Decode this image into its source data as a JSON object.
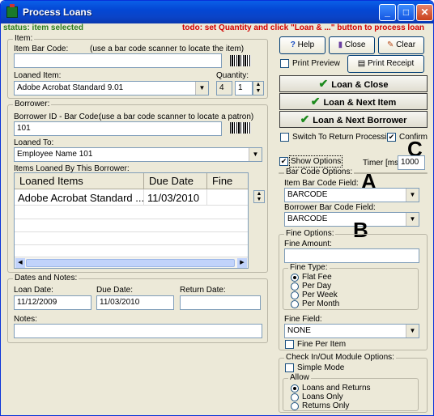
{
  "window": {
    "title": "Process Loans",
    "min": "_",
    "max": "□",
    "close": "✕"
  },
  "status": {
    "left": "status: item selected",
    "right": "todo: set Quantity and click \"Loan & ...\" button to process loan"
  },
  "item": {
    "group": "Item:",
    "barcode_label": "Item Bar Code:",
    "barcode_hint": "(use a bar code scanner to locate the item)",
    "barcode_value": "",
    "loaned_label": "Loaned Item:",
    "loaned_value": "Adobe Acrobat Standard 9.01",
    "quantity_label": "Quantity:",
    "quantity_available": "4",
    "quantity_value": "1"
  },
  "borrower": {
    "group": "Borrower:",
    "id_label": "Borrower ID - Bar Code:",
    "id_hint": "(use a bar code scanner to locate a patron)",
    "id_value": "101",
    "loaned_to_label": "Loaned To:",
    "loaned_to_value": "Employee Name 101",
    "items_label": "Items Loaned By This Borrower:",
    "columns": [
      "Loaned Items",
      "Due Date",
      "Fine"
    ],
    "rows": [
      {
        "item": "Adobe Acrobat Standard ...",
        "due": "11/03/2010",
        "fine": ""
      }
    ]
  },
  "dates": {
    "group": "Dates and Notes:",
    "loan_label": "Loan Date:",
    "loan_value": "11/12/2009",
    "due_label": "Due Date:",
    "due_value": "11/03/2010",
    "return_label": "Return Date:",
    "return_value": "",
    "notes_label": "Notes:",
    "notes_value": ""
  },
  "toolbar": {
    "help": "Help",
    "close": "Close",
    "clear": "Clear",
    "print_preview": "Print Preview",
    "print_receipt": "Print Receipt",
    "loan_close": "Loan & Close",
    "loan_next_item": "Loan & Next Item",
    "loan_next_borrower": "Loan & Next Borrower"
  },
  "options": {
    "switch_return": "Switch To Return Processing",
    "confirm": "Confirm",
    "show_options": "Show Options",
    "timer_label": "Timer [ms]:",
    "timer_value": "1000"
  },
  "barcode_options": {
    "group": "Bar Code Options:",
    "item_field_label": "Item Bar Code Field:",
    "item_field_value": "BARCODE",
    "borrower_field_label": "Borrower Bar Code Field:",
    "borrower_field_value": "BARCODE"
  },
  "fine_options": {
    "group": "Fine Options:",
    "amount_label": "Fine Amount:",
    "amount_value": "",
    "type_label": "Fine Type:",
    "types": [
      "Flat Fee",
      "Per Day",
      "Per Week",
      "Per Month"
    ],
    "field_label": "Fine Field:",
    "field_value": "NONE",
    "per_item": "Fine Per Item"
  },
  "module": {
    "group": "Check In/Out Module Options:",
    "simple_mode": "Simple Mode",
    "allow_label": "Allow",
    "allow": [
      "Loans and Returns",
      "Loans Only",
      "Returns Only"
    ]
  },
  "annotations": {
    "a": "A",
    "b": "B",
    "c": "C"
  }
}
